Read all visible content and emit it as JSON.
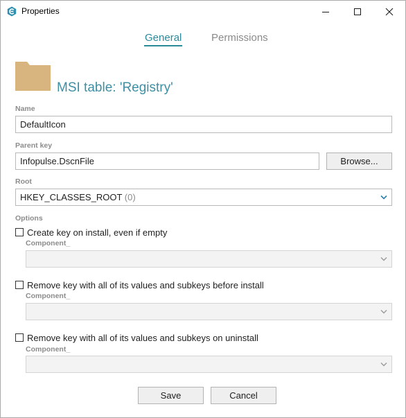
{
  "window": {
    "title": "Properties"
  },
  "tabs": [
    {
      "label": "General",
      "active": true
    },
    {
      "label": "Permissions",
      "active": false
    }
  ],
  "header": {
    "title": "MSI table: 'Registry'",
    "icon": "folder-icon"
  },
  "form": {
    "name": {
      "label": "Name",
      "value": "DefaultIcon"
    },
    "parent_key": {
      "label": "Parent key",
      "value": "Infopulse.DscnFile",
      "browse_label": "Browse..."
    },
    "root": {
      "label": "Root",
      "value": "HKEY_CLASSES_ROOT",
      "code": "(0)"
    },
    "options": {
      "label": "Options",
      "items": [
        {
          "text_parts": [
            "Create key ",
            "on install",
            ", even if empty"
          ],
          "checked": false,
          "component_label": "Component_",
          "component_value": ""
        },
        {
          "text_parts": [
            "Remove key with all of its values and subkeys ",
            "before install",
            ""
          ],
          "checked": false,
          "component_label": "Component_",
          "component_value": ""
        },
        {
          "text_parts": [
            "Remove key with all of its values and subkeys ",
            "on uninstall",
            ""
          ],
          "checked": false,
          "component_label": "Component_",
          "component_value": ""
        }
      ]
    }
  },
  "footer": {
    "save_label": "Save",
    "cancel_label": "Cancel"
  },
  "colors": {
    "accent": "#2b8a9a",
    "title": "#3f8fa3",
    "folder": "#d8b57f",
    "label": "#8c8c8c"
  }
}
